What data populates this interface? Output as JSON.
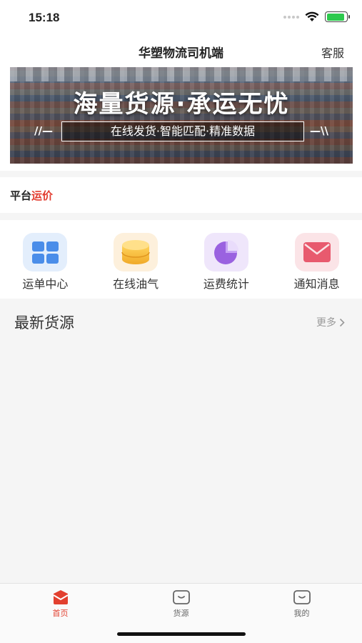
{
  "status_bar": {
    "time": "15:18",
    "battery_level": 0.9,
    "battery_color": "#2dc94d"
  },
  "header": {
    "title": "华塑物流司机端",
    "service_label": "客服"
  },
  "banner": {
    "main_text": "海量货源·承运无忧",
    "sub_text": "在线发货·智能匹配·精准数据",
    "deco_left": "//—",
    "deco_right": "—\\\\"
  },
  "price_section": {
    "title_part1": "平台",
    "title_part2": "运价",
    "accent_color": "#e23b2e"
  },
  "menu": {
    "items": [
      {
        "label": "运单中心",
        "icon": "grid-icon",
        "color": "#4a8de9"
      },
      {
        "label": "在线油气",
        "icon": "oil-barrel-icon",
        "color": "#f5b433"
      },
      {
        "label": "运费统计",
        "icon": "pie-chart-icon",
        "color": "#9a62e0"
      },
      {
        "label": "通知消息",
        "icon": "envelope-icon",
        "color": "#e85a6e"
      }
    ]
  },
  "cargo": {
    "title": "最新货源",
    "more_label": "更多"
  },
  "tab_bar": {
    "items": [
      {
        "label": "首页",
        "icon": "home-icon",
        "active": true
      },
      {
        "label": "货源",
        "icon": "cargo-icon",
        "active": false
      },
      {
        "label": "我的",
        "icon": "profile-icon",
        "active": false
      }
    ],
    "active_color": "#e2402f"
  }
}
